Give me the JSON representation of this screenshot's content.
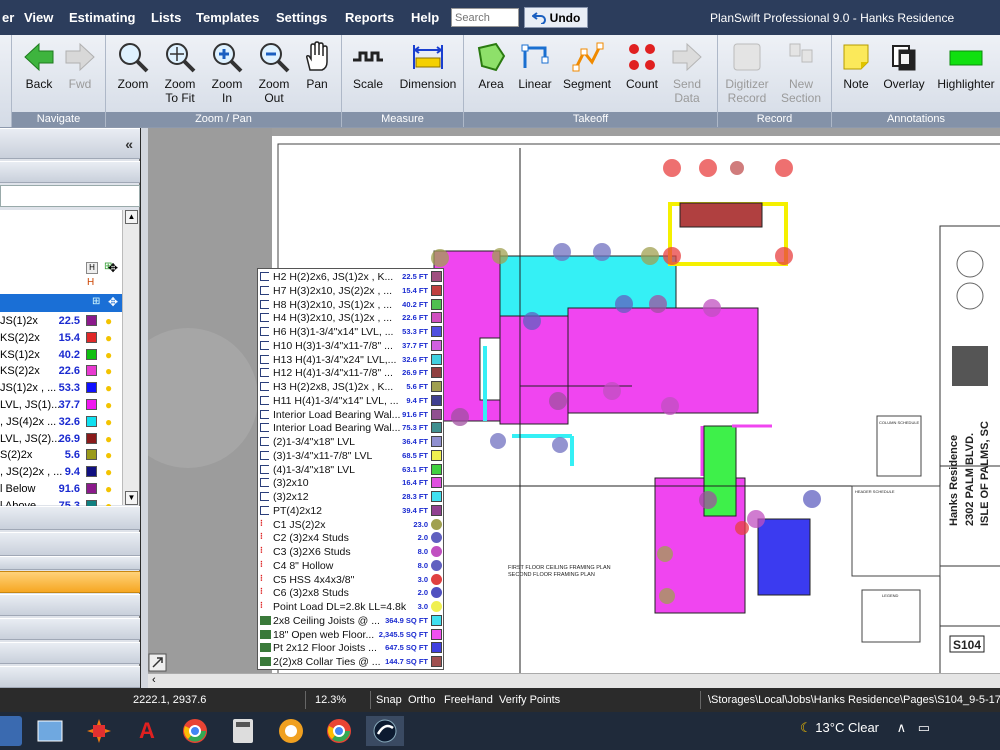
{
  "menubar": {
    "items": [
      "er",
      "View",
      "Estimating",
      "Lists",
      "Templates",
      "Settings",
      "Reports",
      "Help"
    ],
    "search_placeholder": "Search",
    "undo_label": "Undo",
    "window_title": "PlanSwift Professional 9.0 - Hanks Residence"
  },
  "ribbon": {
    "groups": [
      {
        "title": "Navigate",
        "buttons": [
          {
            "label": "Back",
            "icon": "back-arrow-icon",
            "enabled": true
          },
          {
            "label": "Fwd",
            "icon": "forward-arrow-icon",
            "enabled": false
          }
        ]
      },
      {
        "title": "Zoom / Pan",
        "buttons": [
          {
            "label": "Zoom",
            "icon": "magnifier-icon",
            "enabled": true
          },
          {
            "label": "Zoom To Fit",
            "icon": "zoom-fit-icon",
            "enabled": true
          },
          {
            "label": "Zoom In",
            "icon": "zoom-in-icon",
            "enabled": true
          },
          {
            "label": "Zoom Out",
            "icon": "zoom-out-icon",
            "enabled": true
          },
          {
            "label": "Pan",
            "icon": "hand-icon",
            "enabled": true
          }
        ]
      },
      {
        "title": "Measure",
        "buttons": [
          {
            "label": "Scale",
            "icon": "scale-icon",
            "enabled": true
          },
          {
            "label": "Dimension",
            "icon": "dimension-icon",
            "enabled": true
          }
        ]
      },
      {
        "title": "Takeoff",
        "buttons": [
          {
            "label": "Area",
            "icon": "area-icon",
            "enabled": true
          },
          {
            "label": "Linear",
            "icon": "linear-icon",
            "enabled": true
          },
          {
            "label": "Segment",
            "icon": "segment-icon",
            "enabled": true
          },
          {
            "label": "Count",
            "icon": "count-icon",
            "enabled": true
          },
          {
            "label": "Send Data",
            "icon": "send-data-icon",
            "enabled": false
          }
        ]
      },
      {
        "title": "Record",
        "buttons": [
          {
            "label": "Digitizer Record",
            "icon": "digitizer-icon",
            "enabled": false
          },
          {
            "label": "New Section",
            "icon": "new-section-icon",
            "enabled": false
          }
        ]
      },
      {
        "title": "Annotations",
        "buttons": [
          {
            "label": "Note",
            "icon": "note-icon",
            "enabled": true
          },
          {
            "label": "Overlay",
            "icon": "overlay-icon",
            "enabled": true
          },
          {
            "label": "Highlighter",
            "icon": "highlighter-icon",
            "enabled": true
          }
        ]
      }
    ]
  },
  "left_panel": {
    "collapse_label": "«",
    "rows": [
      {
        "name": "JS(1)2x",
        "value": "22.5",
        "color": "#8b1a8b"
      },
      {
        "name": "KS(2)2x",
        "value": "15.4",
        "color": "#e02828"
      },
      {
        "name": "KS(1)2x",
        "value": "40.2",
        "color": "#10c010"
      },
      {
        "name": "KS(2)2x",
        "value": "22.6",
        "color": "#e83ad0"
      },
      {
        "name": "JS(1)2x , ...",
        "value": "53.3",
        "color": "#1010ff"
      },
      {
        "name": "LVL, JS(1)...",
        "value": "37.7",
        "color": "#f018f0"
      },
      {
        "name": ", JS(4)2x ...",
        "value": "32.6",
        "color": "#10e0f0"
      },
      {
        "name": "LVL, JS(2)...",
        "value": "26.9",
        "color": "#8a1a1a"
      },
      {
        "name": "S(2)2x",
        "value": "5.6",
        "color": "#9a9a1a"
      },
      {
        "name": ", JS(2)2x , ...",
        "value": "9.4",
        "color": "#101080"
      },
      {
        "name": "l Below",
        "value": "91.6",
        "color": "#8b1a8b"
      },
      {
        "name": "l Above",
        "value": "75.3",
        "color": "#108080"
      }
    ]
  },
  "legend": {
    "items": [
      {
        "kind": "linear",
        "name": "H2  H(2)2x6, JS(1)2x  , K...",
        "qty": "22.5 FT",
        "color": "#a05080"
      },
      {
        "kind": "linear",
        "name": "H7  H(3)2x10, JS(2)2x  , ...",
        "qty": "15.4 FT",
        "color": "#c04040"
      },
      {
        "kind": "linear",
        "name": "H8  H(3)2x10, JS(1)2x  , ...",
        "qty": "40.2 FT",
        "color": "#50c050"
      },
      {
        "kind": "linear",
        "name": "H4  H(3)2x10, JS(1)2x  , ...",
        "qty": "22.6 FT",
        "color": "#d050c0"
      },
      {
        "kind": "linear",
        "name": "H6  H(3)1-3/4\"x14\" LVL, ...",
        "qty": "53.3 FT",
        "color": "#5050e0"
      },
      {
        "kind": "linear",
        "name": "H10  H(3)1-3/4\"x11-7/8\" ...",
        "qty": "37.7 FT",
        "color": "#d060e0"
      },
      {
        "kind": "linear",
        "name": "H13  H(4)1-3/4\"x24\" LVL,...",
        "qty": "32.6 FT",
        "color": "#40d0e0"
      },
      {
        "kind": "linear",
        "name": "H12  H(4)1-3/4\"x11-7/8\" ...",
        "qty": "26.9 FT",
        "color": "#904040"
      },
      {
        "kind": "linear",
        "name": "H3  H(2)2x8, JS(1)2x  , K...",
        "qty": "5.6 FT",
        "color": "#a0a050"
      },
      {
        "kind": "linear",
        "name": "H11  H(4)1-3/4\"x14\" LVL, ...",
        "qty": "9.4 FT",
        "color": "#404090"
      },
      {
        "kind": "linear",
        "name": "Interior Load Bearing Wal...",
        "qty": "91.6 FT",
        "color": "#905090"
      },
      {
        "kind": "linear",
        "name": "Interior Load Bearing Wal...",
        "qty": "75.3 FT",
        "color": "#409090"
      },
      {
        "kind": "linear",
        "name": "(2)1-3/4\"x18\" LVL",
        "qty": "36.4 FT",
        "color": "#9090d0"
      },
      {
        "kind": "linear",
        "name": "(3)1-3/4\"x11-7/8\" LVL",
        "qty": "68.5 FT",
        "color": "#f0f050"
      },
      {
        "kind": "linear",
        "name": "(4)1-3/4\"x18\" LVL",
        "qty": "63.1 FT",
        "color": "#40d040"
      },
      {
        "kind": "linear",
        "name": "(3)2x10",
        "qty": "16.4 FT",
        "color": "#e050e0"
      },
      {
        "kind": "linear",
        "name": "(3)2x12",
        "qty": "28.3 FT",
        "color": "#40e0f0"
      },
      {
        "kind": "linear",
        "name": "PT(4)2x12",
        "qty": "39.4 FT",
        "color": "#904090"
      },
      {
        "kind": "count",
        "name": "C1  JS(2)2x",
        "qty": "23.0",
        "color": "#a0a050"
      },
      {
        "kind": "count",
        "name": "C2  (3)2x4 Studs",
        "qty": "2.0",
        "color": "#6060c0"
      },
      {
        "kind": "count",
        "name": "C3  (3)2X6 Studs",
        "qty": "8.0",
        "color": "#c050c0"
      },
      {
        "kind": "count",
        "name": "C4  8\" Hollow",
        "qty": "8.0",
        "color": "#6060c0"
      },
      {
        "kind": "count",
        "name": "C5  HSS 4x4x3/8\"",
        "qty": "3.0",
        "color": "#e04040"
      },
      {
        "kind": "count",
        "name": "C6  (3)2x8 Studs",
        "qty": "2.0",
        "color": "#5050c0"
      },
      {
        "kind": "count",
        "name": "Point Load DL=2.8k LL=4.8k",
        "qty": "3.0",
        "color": "#f0f050"
      },
      {
        "kind": "area",
        "name": "2x8 Ceiling Joists @ ...",
        "qty": "364.9 SQ FT",
        "color": "#40e0f0"
      },
      {
        "kind": "area",
        "name": "18\" Open web Floor...",
        "qty": "2,345.5 SQ FT",
        "color": "#f050f0"
      },
      {
        "kind": "area",
        "name": "Pt 2x12 Floor Joists ...",
        "qty": "647.5 SQ FT",
        "color": "#4040e0"
      },
      {
        "kind": "area",
        "name": "2(2)x8 Collar Ties @ ...",
        "qty": "144.7 SQ FT",
        "color": "#a05050"
      }
    ]
  },
  "drawing": {
    "plan_title": "FIRST FLOOR CEILING FRAMING PLAN",
    "plan_subtitle": "SECOND FLOOR FRAMING PLAN",
    "project_name": "Hanks Residence",
    "project_address": "2302 PALM BLVD.",
    "project_city": "ISLE OF PALMS, SC",
    "sheet_number": "S104",
    "column_schedule_title": "COLUMN SCHEDULE",
    "header_schedule_title": "HEADER SCHEDULE",
    "legend_title": "LEGEND"
  },
  "statusbar": {
    "coords": "2222.1, 2937.6",
    "zoom": "12.3%",
    "snap": "Snap",
    "ortho": "Ortho",
    "freehand": "FreeHand",
    "verify": "Verify Points",
    "path": "\\Storages\\Local\\Jobs\\Hanks Residence\\Pages\\S104_9-5-17"
  },
  "taskbar": {
    "weather": "13°C  Clear"
  },
  "colors": {
    "menubar": "#2c3d5c",
    "cyan_area": "#35f0f5",
    "magenta_area": "#f045f0",
    "blue_area": "#3b3bf0",
    "brown_area": "#b04040",
    "yellow_line": "#f5f000",
    "selection": "#1a6fd6"
  }
}
